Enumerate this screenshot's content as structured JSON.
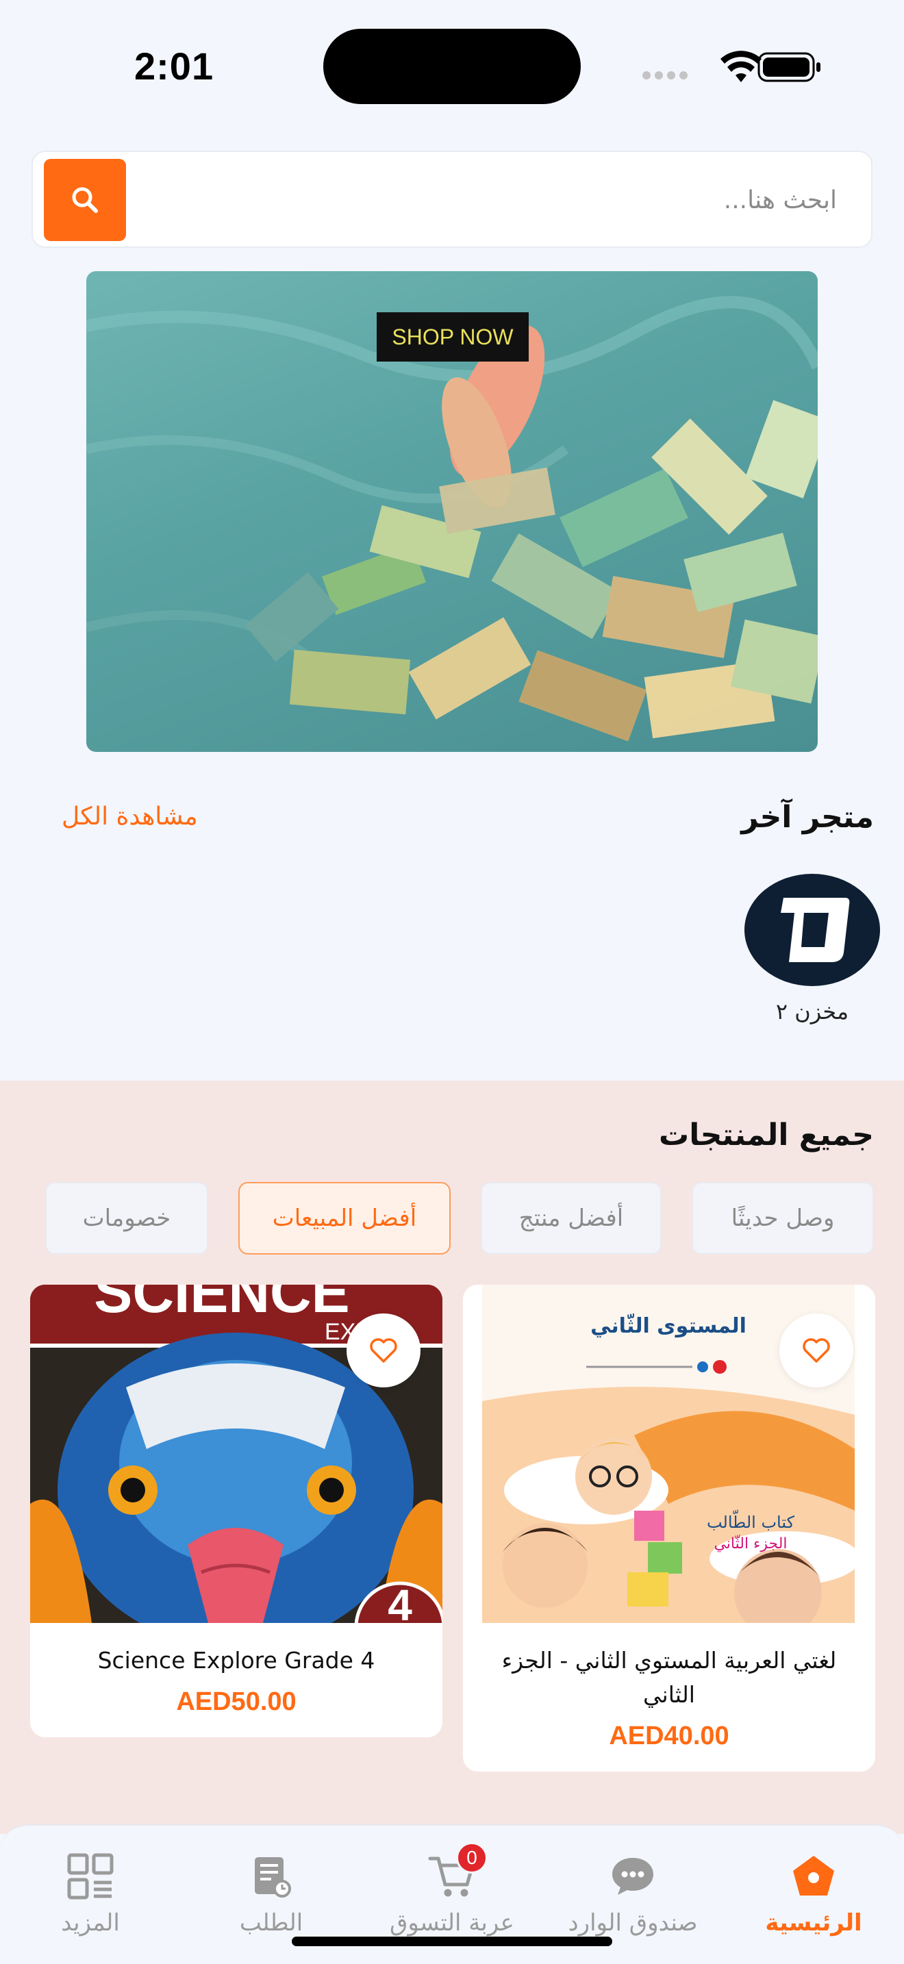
{
  "status_bar": {
    "time": "2:01"
  },
  "search": {
    "placeholder": "ابحث هنا..."
  },
  "banner": {
    "cta_label": "SHOP NOW"
  },
  "other_store": {
    "title": "متجر آخر",
    "view_all": "مشاهدة الكل",
    "stores": [
      {
        "name": "مخزن ٢"
      }
    ]
  },
  "all_products": {
    "title": "جميع المنتجات",
    "filters": [
      {
        "label": "وصل حديثًا",
        "active": false
      },
      {
        "label": "أفضل منتج",
        "active": false
      },
      {
        "label": "أفضل المبيعات",
        "active": true
      },
      {
        "label": "خصومات",
        "active": false
      }
    ],
    "products": [
      {
        "title": "لغتي العربية المستوي الثاني - الجزء الثاني",
        "price": "AED40.00",
        "cover_heading": "المستوى الثّاني",
        "cover_subtitle": "كتاب الطّالب الجزء الثّاني"
      },
      {
        "title": "Science Explore Grade 4",
        "price": "AED50.00",
        "cover_heading": "SCIENCE",
        "cover_badge": "4"
      }
    ]
  },
  "bottom_nav": {
    "items": [
      {
        "label": "الرئيسية",
        "icon": "home-icon",
        "active": true
      },
      {
        "label": "صندوق الوارد",
        "icon": "chat-icon",
        "active": false
      },
      {
        "label": "عربة التسوق",
        "icon": "cart-icon",
        "active": false,
        "badge": "0"
      },
      {
        "label": "الطلب",
        "icon": "order-icon",
        "active": false
      },
      {
        "label": "المزيد",
        "icon": "more-icon",
        "active": false
      }
    ]
  },
  "colors": {
    "accent": "#ff6a13",
    "badge": "#e0252b",
    "panel": "#f6e6e3"
  }
}
